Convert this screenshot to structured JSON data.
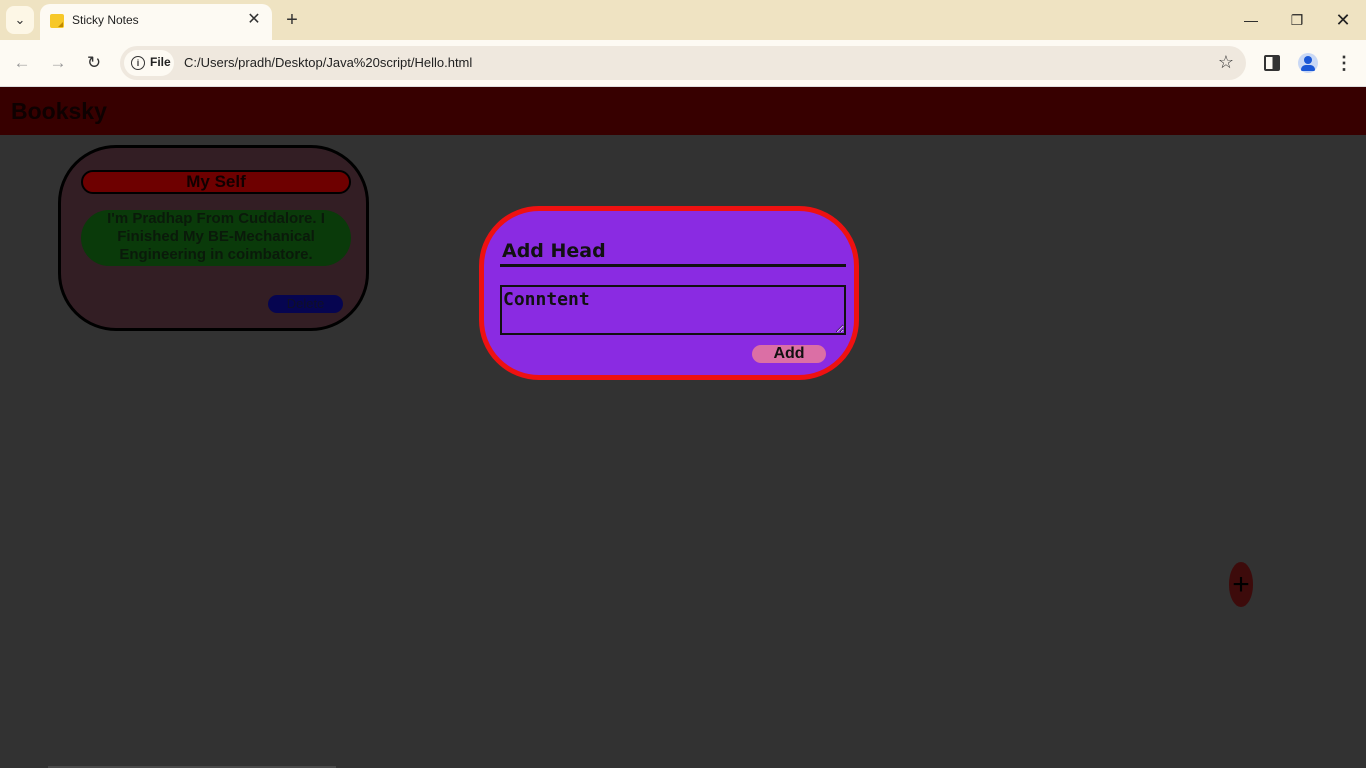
{
  "browser": {
    "tab": {
      "title": "Sticky Notes",
      "close_glyph": "✕",
      "favicon": "sticky-note-icon"
    },
    "tab_search_glyph": "⌄",
    "new_tab_glyph": "+",
    "window_controls": {
      "minimize_glyph": "—",
      "restore_glyph": "❐",
      "close_glyph": "✕"
    },
    "nav": {
      "back_glyph": "←",
      "forward_glyph": "→",
      "reload_glyph": "↻"
    },
    "address": {
      "chip_label": "File",
      "url": "C:/Users/pradh/Desktop/Java%20script/Hello.html",
      "star_glyph": "☆"
    },
    "menu_glyph": "⋮"
  },
  "page": {
    "brand": "Booksky",
    "notes": [
      {
        "title": "My Self",
        "content": "I'm Pradhap From Cuddalore. I Finished My BE-Mechanical Engineering in coimbatore.",
        "delete_label": "Delete"
      }
    ],
    "form": {
      "head_placeholder": "Add Head",
      "content_placeholder": "Conntent",
      "add_label": "Add"
    },
    "fab_glyph": "+"
  },
  "colors": {
    "page_bg": "#323232",
    "header_bg": "#370000",
    "note_bg": "#331e24",
    "note_head_bg": "#6e0000",
    "note_body_bg": "#0a3a0a",
    "delete_bg": "#060550",
    "form_bg": "#8a2be2",
    "form_border": "#ee1111",
    "add_button_bg": "#db6fa5",
    "fab_bg": "#3d0b0b"
  }
}
